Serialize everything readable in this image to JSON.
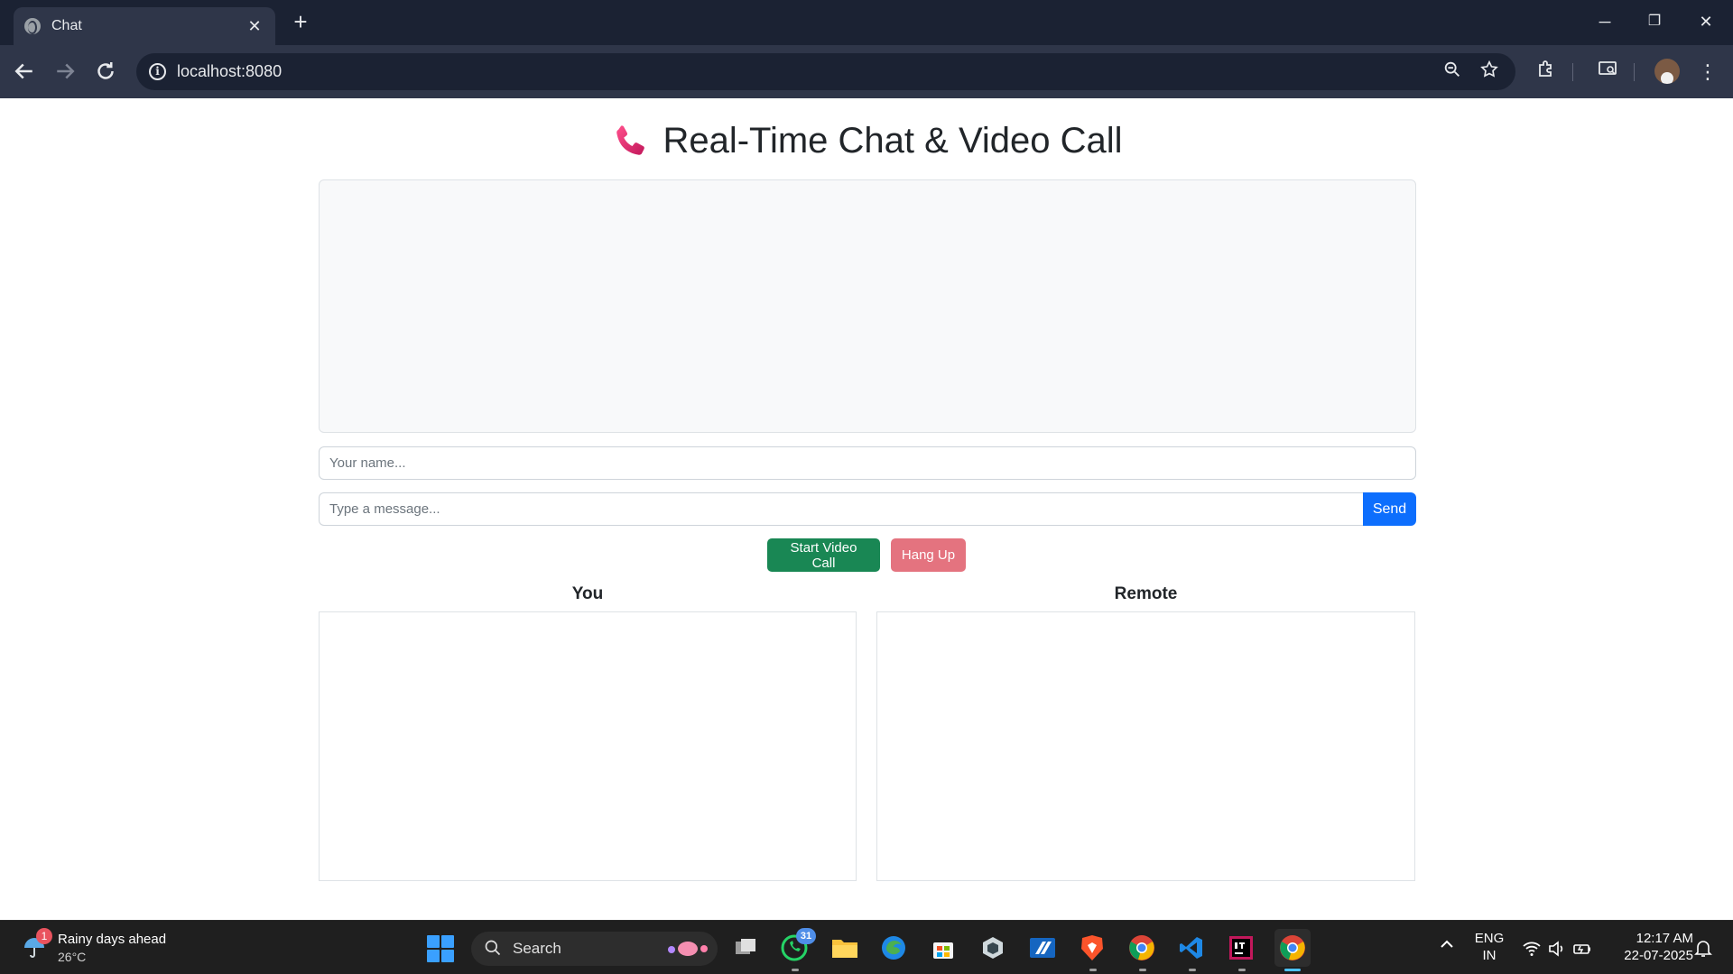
{
  "browser": {
    "tab_title": "Chat",
    "tab_close_label": "✕",
    "new_tab_label": "+",
    "url": "localhost:8080",
    "window_controls": [
      "─",
      "❐",
      "✕"
    ]
  },
  "page": {
    "heading": "Real-Time Chat & Video Call",
    "name_placeholder": "Your name...",
    "message_placeholder": "Type a message...",
    "send_label": "Send",
    "start_call_label": "Start Video Call",
    "hang_up_label": "Hang Up",
    "local_video_label": "You",
    "remote_video_label": "Remote"
  },
  "taskbar": {
    "weather_title": "Rainy days ahead",
    "weather_temp": "26°C",
    "weather_badge": "1",
    "search_label": "Search",
    "whatsapp_badge": "31",
    "lang_line1": "ENG",
    "lang_line2": "IN",
    "time": "12:17 AM",
    "date": "22-07-2025"
  },
  "colors": {
    "primary": "#0d6efd",
    "success": "#198754",
    "danger_disabled": "#e4737f",
    "chrome_dark": "#1b2233",
    "chrome_toolbar": "#2f3649"
  }
}
